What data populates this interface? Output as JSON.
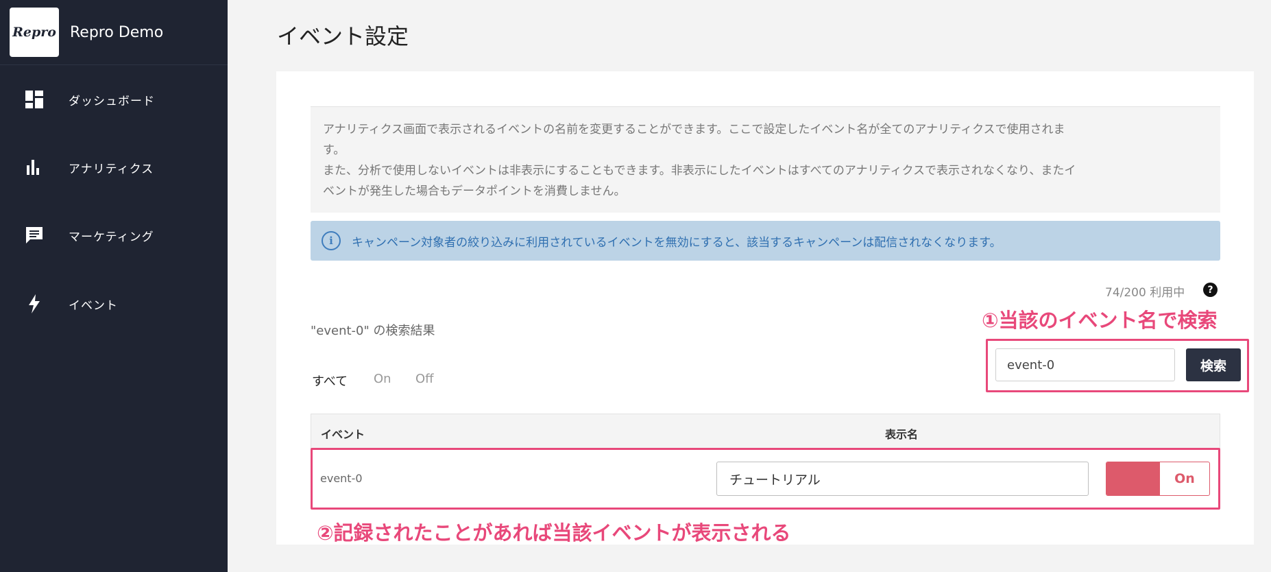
{
  "app": {
    "logo_text": "Repro",
    "name": "Repro Demo"
  },
  "sidebar": {
    "items": [
      {
        "label": "ダッシュボード",
        "icon": "dashboard-icon"
      },
      {
        "label": "アナリティクス",
        "icon": "bar-chart-icon"
      },
      {
        "label": "マーケティング",
        "icon": "chat-icon"
      },
      {
        "label": "イベント",
        "icon": "lightning-icon"
      }
    ]
  },
  "main": {
    "title": "イベント設定",
    "description_lines": [
      "アナリティクス画面で表示されるイベントの名前を変更することができます。ここで設定したイベント名が全てのアナリティクスで使用されま",
      "す。",
      "また、分析で使用しないイベントは非表示にすることもできます。非表示にしたイベントはすべてのアナリティクスで表示されなくなり、またイ",
      "ベントが発生した場合もデータポイントを消費しません。"
    ],
    "info_banner": "キャンペーン対象者の絞り込みに利用されているイベントを無効にすると、該当するキャンペーンは配信されなくなります。",
    "usage": "74/200 利用中",
    "help_icon_glyph": "?",
    "search_result_label": "\"event-0\" の検索結果",
    "filter_tabs": [
      "すべて",
      "On",
      "Off"
    ],
    "search": {
      "value": "event-0",
      "button_label": "検索"
    },
    "table": {
      "headers": [
        "イベント",
        "表示名"
      ],
      "rows": [
        {
          "event": "event-0",
          "display_name": "チュートリアル",
          "toggle_label": "On",
          "enabled": true
        }
      ]
    }
  },
  "annotations": {
    "first": "①当該のイベント名で検索",
    "second": "②記録されたことがあれば当該イベントが表示される"
  },
  "colors": {
    "sidebar_bg": "#1f2432",
    "accent_pink": "#e8487a",
    "toggle_red": "#dd5a6b",
    "info_blue": "#2f6fb0"
  }
}
